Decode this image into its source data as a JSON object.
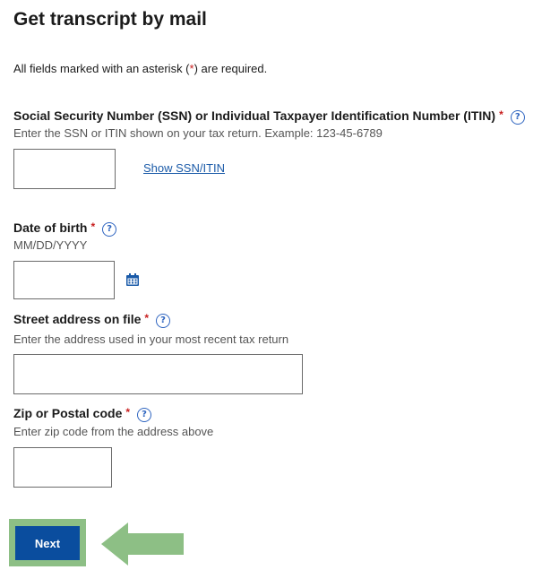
{
  "page": {
    "title": "Get transcript by mail",
    "required_note_prefix": "All fields marked with an asterisk (",
    "required_note_asterisk": "*",
    "required_note_suffix": ") are required."
  },
  "fields": {
    "ssn": {
      "label": "Social Security Number (SSN) or Individual Taxpayer Identification Number (ITIN)",
      "required_mark": "*",
      "help": "?",
      "hint": "Enter the SSN or ITIN shown on your tax return. Example: 123-45-6789",
      "value": "",
      "show_link": "Show SSN/ITIN"
    },
    "dob": {
      "label": "Date of birth",
      "required_mark": "*",
      "help": "?",
      "hint": "MM/DD/YYYY",
      "value": ""
    },
    "address": {
      "label": "Street address on file",
      "required_mark": "*",
      "help": "?",
      "hint": "Enter the address used in your most recent tax return",
      "value": ""
    },
    "zip": {
      "label": "Zip or Postal code",
      "required_mark": "*",
      "help": "?",
      "hint": "Enter zip code from the address above",
      "value": ""
    }
  },
  "actions": {
    "next_label": "Next"
  },
  "colors": {
    "primary_button": "#0a4d9e",
    "link": "#1a5aa8",
    "required": "#c81e1e",
    "highlight_green": "#8dbf85",
    "arrow_green": "#8dbf85"
  },
  "icons": {
    "help": "question-circle-icon",
    "calendar": "calendar-icon",
    "arrow": "left-arrow-icon"
  }
}
